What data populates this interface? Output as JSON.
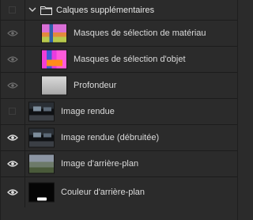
{
  "layers_panel": {
    "group": {
      "label": "Calques supplémentaires",
      "expanded": true,
      "icons": [
        "eye-hidden",
        "chevron-down-icon",
        "folder-icon"
      ]
    },
    "nested_layers": [
      {
        "label": "Masques de sélection de matériau",
        "visible": true
      },
      {
        "label": "Masques de sélection d'objet",
        "visible": true
      },
      {
        "label": "Profondeur",
        "visible": true
      }
    ],
    "layers": [
      {
        "label": "Image rendue",
        "visible": false
      },
      {
        "label": "Image rendue (débruitée)",
        "visible": true
      },
      {
        "label": "Image d'arrière-plan",
        "visible": true
      },
      {
        "label": "Couleur d'arrière-plan",
        "visible": true
      }
    ]
  },
  "colors": {
    "panel_bg": "#2b2b2b",
    "divider": "#1c1c1c",
    "text": "#dadada",
    "eye_dim": "#6f6f6f",
    "eye_bright": "#e0e0e0"
  }
}
